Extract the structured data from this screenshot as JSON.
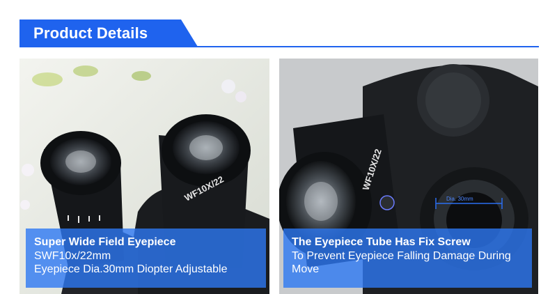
{
  "header": {
    "title": "Product Details"
  },
  "panels": [
    {
      "caption_title": "Super Wide Field Eyepiece",
      "caption_lines": [
        "SWF10x/22mm",
        "Eyepiece Dia.30mm Diopter Adjustable"
      ],
      "eyepiece_text": "WF10X/22"
    },
    {
      "caption_title": "The Eyepiece Tube Has Fix Screw",
      "caption_lines": [
        "To Prevent Eyepiece Falling Damage During",
        "Move"
      ],
      "eyepiece_text": "WF10X/22",
      "dimension_label": "Dia. 30mm"
    }
  ],
  "colors": {
    "accent": "#1f63ee",
    "caption_bg": "rgba(45,120,242,0.80)"
  }
}
